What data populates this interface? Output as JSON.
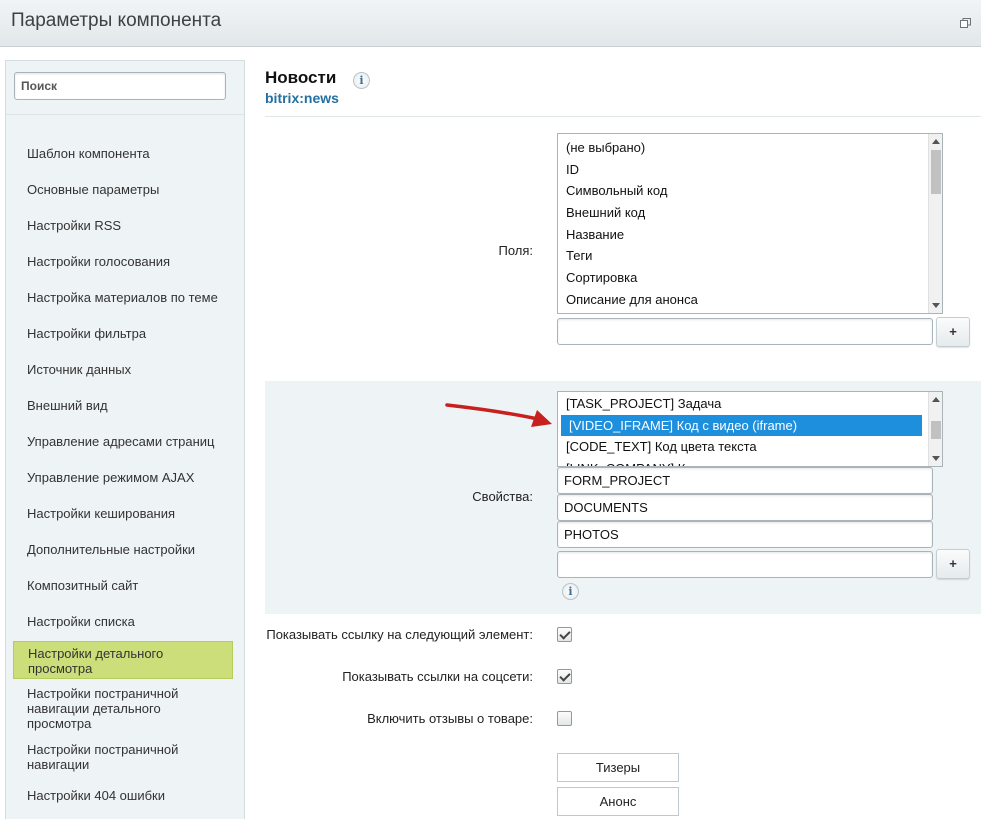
{
  "window": {
    "title": "Параметры компонента"
  },
  "sidebar": {
    "search_placeholder": "Поиск",
    "items": [
      {
        "label": "Шаблон компонента"
      },
      {
        "label": "Основные параметры"
      },
      {
        "label": "Настройки RSS"
      },
      {
        "label": "Настройки голосования"
      },
      {
        "label": "Настройка материалов по теме"
      },
      {
        "label": "Настройки фильтра"
      },
      {
        "label": "Источник данных"
      },
      {
        "label": "Внешний вид"
      },
      {
        "label": "Управление адресами страниц"
      },
      {
        "label": "Управление режимом AJAX"
      },
      {
        "label": "Настройки кеширования"
      },
      {
        "label": "Дополнительные настройки"
      },
      {
        "label": "Композитный сайт"
      },
      {
        "label": "Настройки списка"
      },
      {
        "label": "Настройки детального просмотра",
        "active": true
      },
      {
        "label": "Настройки постраничной навигации детального просмотра"
      },
      {
        "label": "Настройки постраничной навигации"
      },
      {
        "label": "Настройки 404 ошибки"
      }
    ]
  },
  "component": {
    "name": "Новости",
    "code": "bitrix:news",
    "info_glyph": "i"
  },
  "fields": {
    "label": "Поля:",
    "options": [
      "(не выбрано)",
      "ID",
      "Символьный код",
      "Внешний код",
      "Название",
      "Теги",
      "Сортировка",
      "Описание для анонса"
    ],
    "input_value": "",
    "add_label": "+"
  },
  "properties": {
    "label": "Свойства:",
    "options": [
      "[TASK_PROJECT] Задача",
      "[VIDEO_IFRAME] Код с видео (iframe)",
      "[CODE_TEXT] Код цвета текста",
      "[LINK_COMPANY] Компания"
    ],
    "selected": "[VIDEO_IFRAME] Код с видео (iframe)",
    "values": [
      "FORM_PROJECT",
      "DOCUMENTS",
      "PHOTOS"
    ],
    "input_value": "",
    "add_label": "+",
    "info_glyph": "i"
  },
  "options": [
    {
      "label": "Показывать ссылку на следующий элемент:",
      "checked": true
    },
    {
      "label": "Показывать ссылки на соцсети:",
      "checked": true
    },
    {
      "label": "Включить отзывы о товаре:",
      "checked": false
    }
  ],
  "buttons": {
    "teasers": "Тизеры",
    "announce": "Анонс"
  },
  "colors": {
    "accent_selection": "#1e8fdd",
    "active_nav": "#cbde7a",
    "arrow": "#c8201e",
    "link": "#2470a0"
  }
}
